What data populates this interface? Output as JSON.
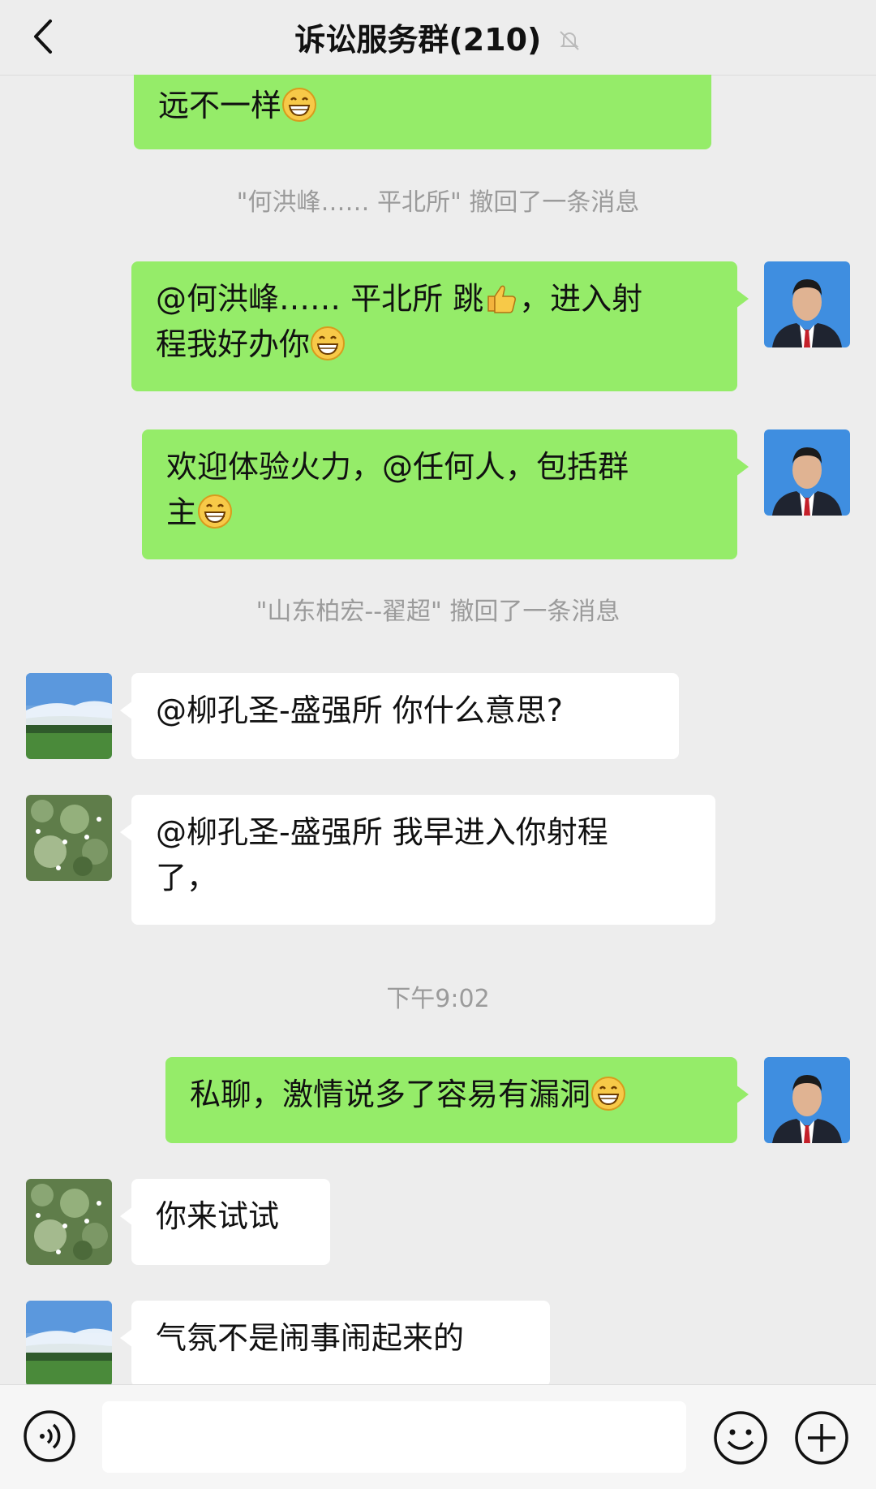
{
  "header": {
    "title": "诉讼服务群(210)",
    "back_icon": "chevron-left-icon",
    "mute_icon": "bell-muted-icon"
  },
  "messages": [
    {
      "type": "outgoing",
      "text": "远不一样",
      "emoji": "grin"
    },
    {
      "type": "system",
      "text": "\"何洪峰…… 平北所\" 撤回了一条消息"
    },
    {
      "type": "outgoing",
      "line1": "@何洪峰…… 平北所 跳",
      "line1b": "，进入射",
      "line2": "程我好办你",
      "emoji": "grin"
    },
    {
      "type": "outgoing",
      "line1": "欢迎体验火力，@任何人，包括群",
      "line2": "主",
      "emoji": "grin"
    },
    {
      "type": "system",
      "text": "\"山东柏宏--翟超\" 撤回了一条消息"
    },
    {
      "type": "incoming",
      "text": "@柳孔圣-盛强所 你什么意思?"
    },
    {
      "type": "incoming",
      "line1": "@柳孔圣-盛强所 我早进入你射程",
      "line2": "了，"
    },
    {
      "type": "time",
      "text": "下午9:02"
    },
    {
      "type": "outgoing",
      "text": "私聊，激情说多了容易有漏洞",
      "emoji": "grin"
    },
    {
      "type": "incoming",
      "text": "你来试试"
    },
    {
      "type": "incoming",
      "text": "气氛不是闹事闹起来的"
    }
  ],
  "inputbar": {
    "voice_icon": "voice-icon",
    "input_value": "",
    "emoji_icon": "smiley-icon",
    "plus_icon": "plus-icon"
  },
  "colors": {
    "background": "#ededed",
    "outgoing_bubble": "#95ec69",
    "incoming_bubble": "#ffffff",
    "system_text": "#9b9b9b"
  }
}
